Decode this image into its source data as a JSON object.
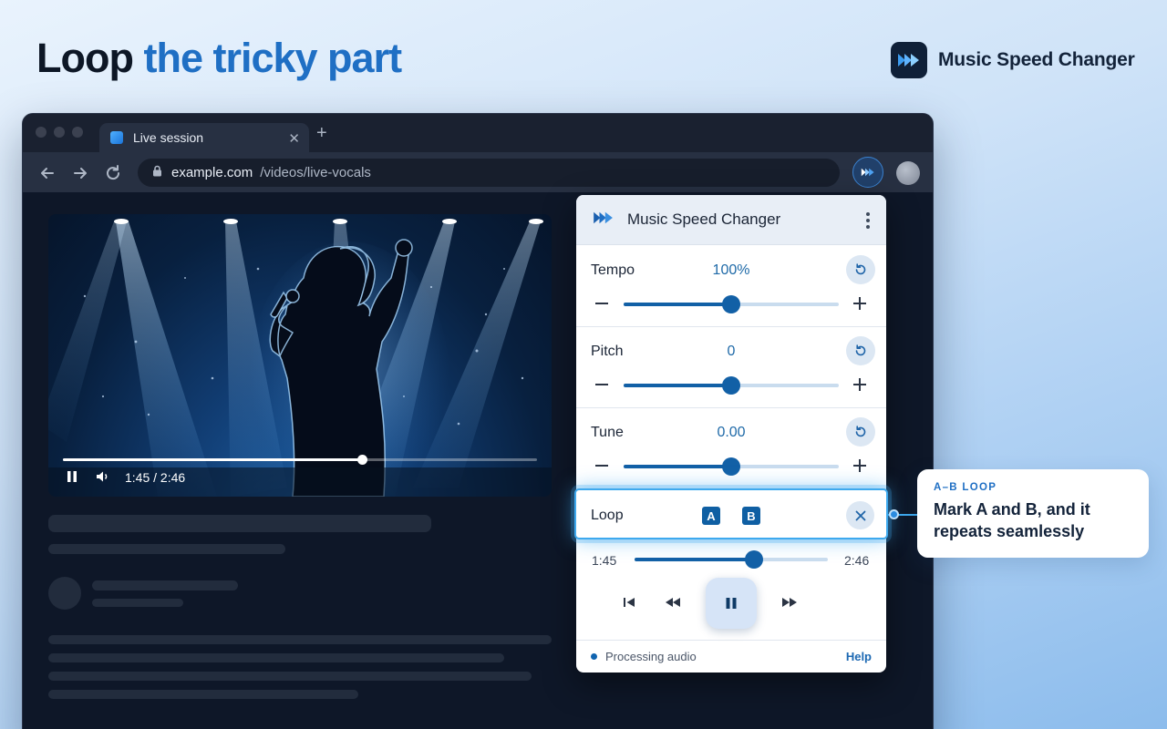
{
  "headline": {
    "part1": "Loop",
    "part2": "the tricky part"
  },
  "brand": {
    "name": "Music Speed Changer",
    "logo_icon": "fast-forward-icon",
    "accent": "#1f6fc4"
  },
  "browser": {
    "tab_title": "Live session",
    "url_host": "example.com",
    "url_path": "/videos/live-vocals"
  },
  "video": {
    "time": "1:45 / 2:46",
    "progress": 0.63
  },
  "extension": {
    "title": "Music Speed Changer",
    "controls": [
      {
        "label": "Tempo",
        "value": "100%",
        "level": 0.5
      },
      {
        "label": "Pitch",
        "value": "0",
        "level": 0.5
      },
      {
        "label": "Tune",
        "value": "0.00",
        "level": 0.5
      }
    ],
    "loop": {
      "label": "Loop",
      "a_label": "A",
      "b_label": "B"
    },
    "position": {
      "start": "1:45",
      "end": "2:46",
      "level": 0.62
    },
    "status": "Processing audio",
    "help": "Help"
  },
  "callout": {
    "kicker": "A–B LOOP",
    "text": "Mark A and B, and it repeats seamlessly"
  },
  "colors": {
    "highlight": "#3ea9ee",
    "slider": "#1260a6"
  }
}
